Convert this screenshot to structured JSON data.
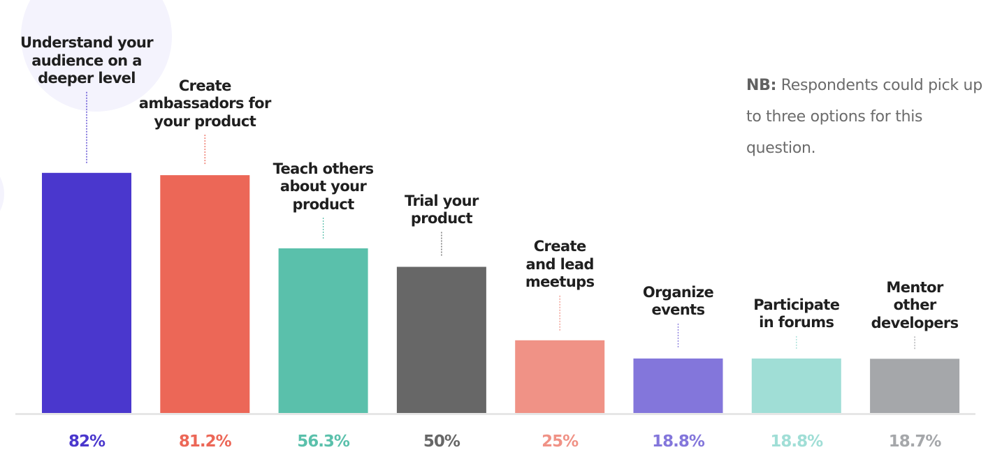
{
  "chart_data": {
    "type": "bar",
    "title": "",
    "xlabel": "",
    "ylabel": "",
    "ylim": [
      0,
      100
    ],
    "grid": false,
    "legend": "none",
    "categories": [
      "Understand your\naudience on a\ndeeper level",
      "Create\nambassadors for\nyour product",
      "Teach others\nabout your\nproduct",
      "Trial your\nproduct",
      "Create\nand lead\nmeetups",
      "Organize\nevents",
      "Participate\nin forums",
      "Mentor\nother\ndevelopers"
    ],
    "values": [
      82,
      81.2,
      56.3,
      50,
      25,
      18.8,
      18.8,
      18.7
    ],
    "value_labels": [
      "82%",
      "81.2%",
      "56.3%",
      "50%",
      "25%",
      "18.8%",
      "18.8%",
      "18.7%"
    ],
    "colors": [
      "#4a37cd",
      "#ec6757",
      "#5ac0ab",
      "#676767",
      "#f09286",
      "#8376db",
      "#a0ded6",
      "#a5a7aa"
    ],
    "annotation": {
      "bold": "NB:",
      "text": " Respondents could pick up to three options for this question."
    }
  },
  "theme": {
    "label_color": "#1f1f1f",
    "baseline_color": "#e6e6e6",
    "background_accent": "#f4f3fd"
  }
}
